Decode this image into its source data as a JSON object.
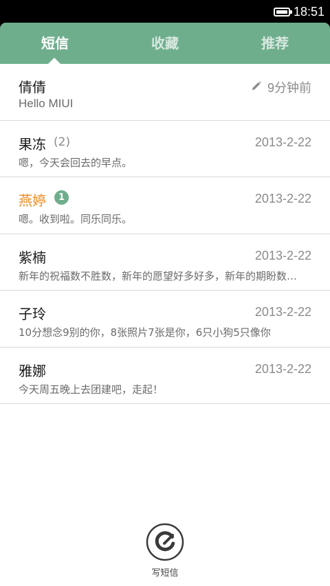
{
  "status_bar": {
    "time": "18:51",
    "battery_icon": "battery-full-icon"
  },
  "tabs": [
    {
      "label": "短信",
      "active": true
    },
    {
      "label": "收藏",
      "active": false
    },
    {
      "label": "推荐",
      "active": false
    }
  ],
  "messages": [
    {
      "name": "倩倩",
      "preview": "Hello MIUI",
      "time": "9分钟前",
      "draft": true
    },
    {
      "name": "果冻",
      "count": "(2)",
      "preview": "嗯，今天会回去的早点。",
      "time": "2013-2-22"
    },
    {
      "name": "燕婷",
      "badge": "1",
      "preview": "嗯。收到啦。同乐同乐。",
      "time": "2013-2-22",
      "unread": true
    },
    {
      "name": "紫楠",
      "preview": "新年的祝福数不胜数，新年的愿望好多好多，新年的期盼数不完，新年的思念说不尽",
      "time": "2013-2-22"
    },
    {
      "name": "子玲",
      "preview": "10分想念9别的你，8张照片7张是你，6只小狗5只像你",
      "time": "2013-2-22"
    },
    {
      "name": "雅娜",
      "preview": "今天周五晚上去团建吧，走起！",
      "time": "2013-2-22"
    }
  ],
  "compose": {
    "label": "写短信"
  },
  "colors": {
    "accent": "#6fae8d",
    "unread_name": "#f08a1c"
  }
}
